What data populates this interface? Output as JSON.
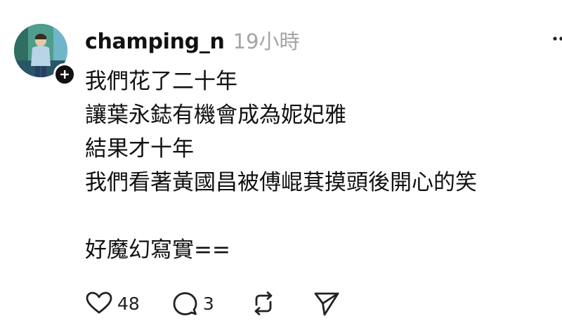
{
  "post": {
    "username": "champing_n",
    "timestamp": "19小時",
    "lines": [
      "我們花了二十年",
      "讓葉永鋕有機會成為妮妃雅",
      "結果才十年",
      "我們看著黃國昌被傅崐萁摸頭後開心的笑",
      "",
      "好魔幻寫實=="
    ],
    "actions": {
      "like_icon": "heart-icon",
      "like_count": "48",
      "reply_icon": "comment-bubble-icon",
      "reply_count": "3",
      "repost_icon": "repost-icon",
      "share_icon": "send-icon"
    },
    "follow_icon": "plus-icon",
    "more_icon": "ellipsis-icon"
  }
}
